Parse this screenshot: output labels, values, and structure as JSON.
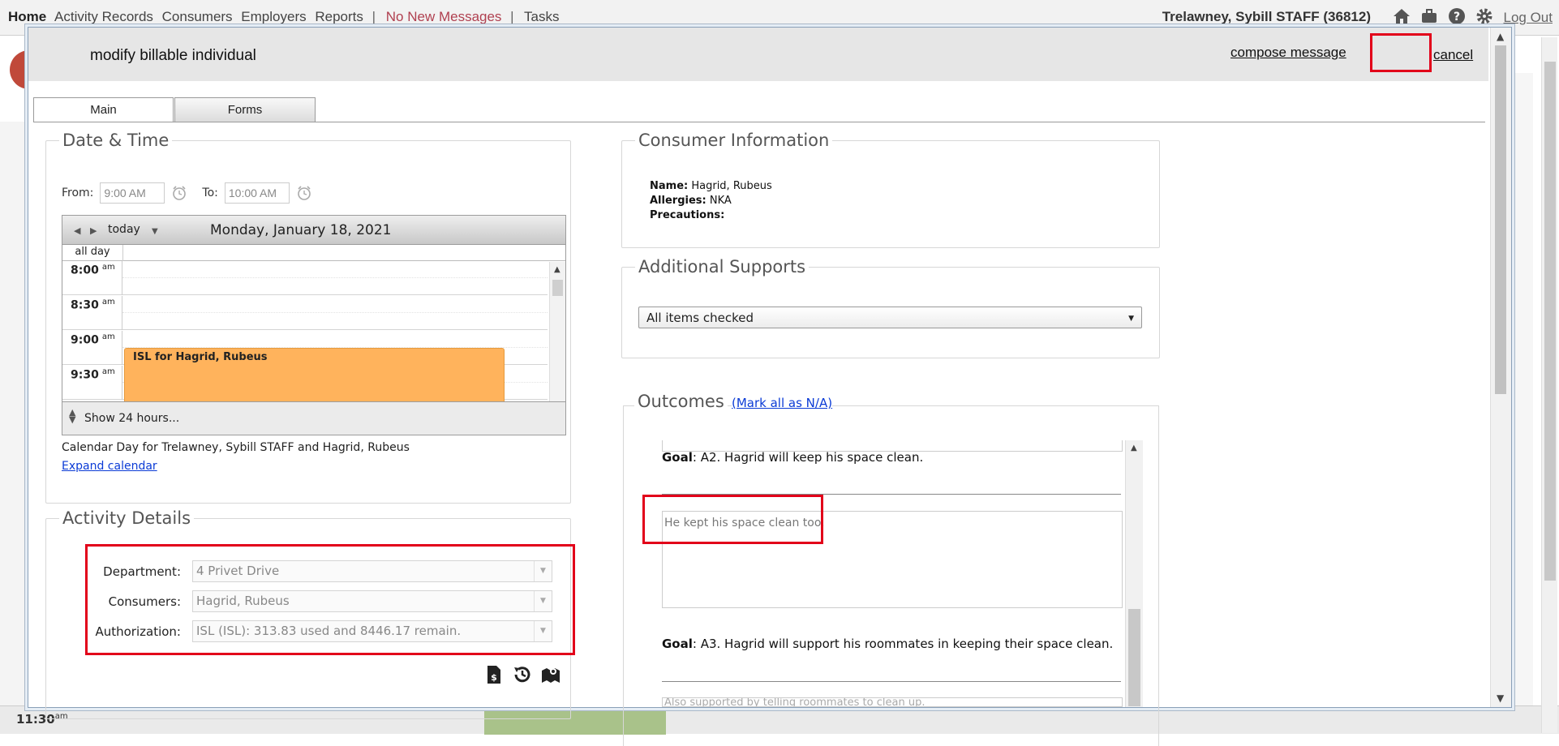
{
  "topbar": {
    "nav_home": "Home",
    "nav_activity": "Activity Records",
    "nav_consumers": "Consumers",
    "nav_employers": "Employers",
    "nav_reports": "Reports",
    "sep1": "|",
    "nav_messages": "No New Messages",
    "sep2": "|",
    "nav_tasks": "Tasks",
    "user": "Trelawney, Sybill STAFF (36812)",
    "logout": "Log Out",
    "icons": [
      "home-icon",
      "briefcase-icon",
      "help-icon",
      "gear-icon"
    ]
  },
  "background": {
    "time_label": "11:30",
    "time_suffix": "am"
  },
  "modal": {
    "title": "modify billable individual",
    "compose": "compose message",
    "cancel": "cancel",
    "tabs": [
      "Main",
      "Forms"
    ]
  },
  "datetime": {
    "legend": "Date & Time",
    "from_label": "From:",
    "from_value": "9:00 AM",
    "to_label": "To:",
    "to_value": "10:00 AM"
  },
  "calendar": {
    "today": "today",
    "date": "Monday, January 18, 2021",
    "all_day": "all day",
    "slots": [
      {
        "time": "8:00",
        "ampm": "am"
      },
      {
        "time": "8:30",
        "ampm": "am"
      },
      {
        "time": "9:00",
        "ampm": "am"
      },
      {
        "time": "9:30",
        "ampm": "am"
      }
    ],
    "event": "ISL for Hagrid, Rubeus",
    "show_hours": "Show 24 hours...",
    "caption": "Calendar Day for Trelawney, Sybill STAFF and Hagrid, Rubeus",
    "expand": "Expand calendar"
  },
  "activity": {
    "legend": "Activity Details",
    "department_label": "Department:",
    "department_value": "4 Privet Drive",
    "consumers_label": "Consumers:",
    "consumers_value": "Hagrid, Rubeus",
    "authorization_label": "Authorization:",
    "authorization_value": "ISL (ISL): 313.83 used and 8446.17 remain.",
    "icons": [
      "billing-document-icon",
      "history-icon",
      "map-icon"
    ]
  },
  "consumer": {
    "legend": "Consumer Information",
    "name_label": "Name:",
    "name_value": "Hagrid, Rubeus",
    "allergies_label": "Allergies:",
    "allergies_value": "NKA",
    "precautions_label": "Precautions:",
    "precautions_value": ""
  },
  "supports": {
    "legend": "Additional Supports",
    "selected": "All items checked"
  },
  "outcomes": {
    "legend": "Outcomes",
    "mark_all": "(Mark all as N/A)",
    "goals": [
      {
        "prefix": "Goal",
        "text": ": A2. Hagrid will keep his space clean.",
        "note": "He kept his space clean too."
      },
      {
        "prefix": "Goal",
        "text": ": A3. Hagrid will support his roommates in keeping their space clean.",
        "note": "Also supported by telling roommates to clean up."
      }
    ]
  },
  "colors": {
    "highlight": "#e2001a",
    "event": "#ffb35c",
    "link": "#0b3bd6"
  }
}
